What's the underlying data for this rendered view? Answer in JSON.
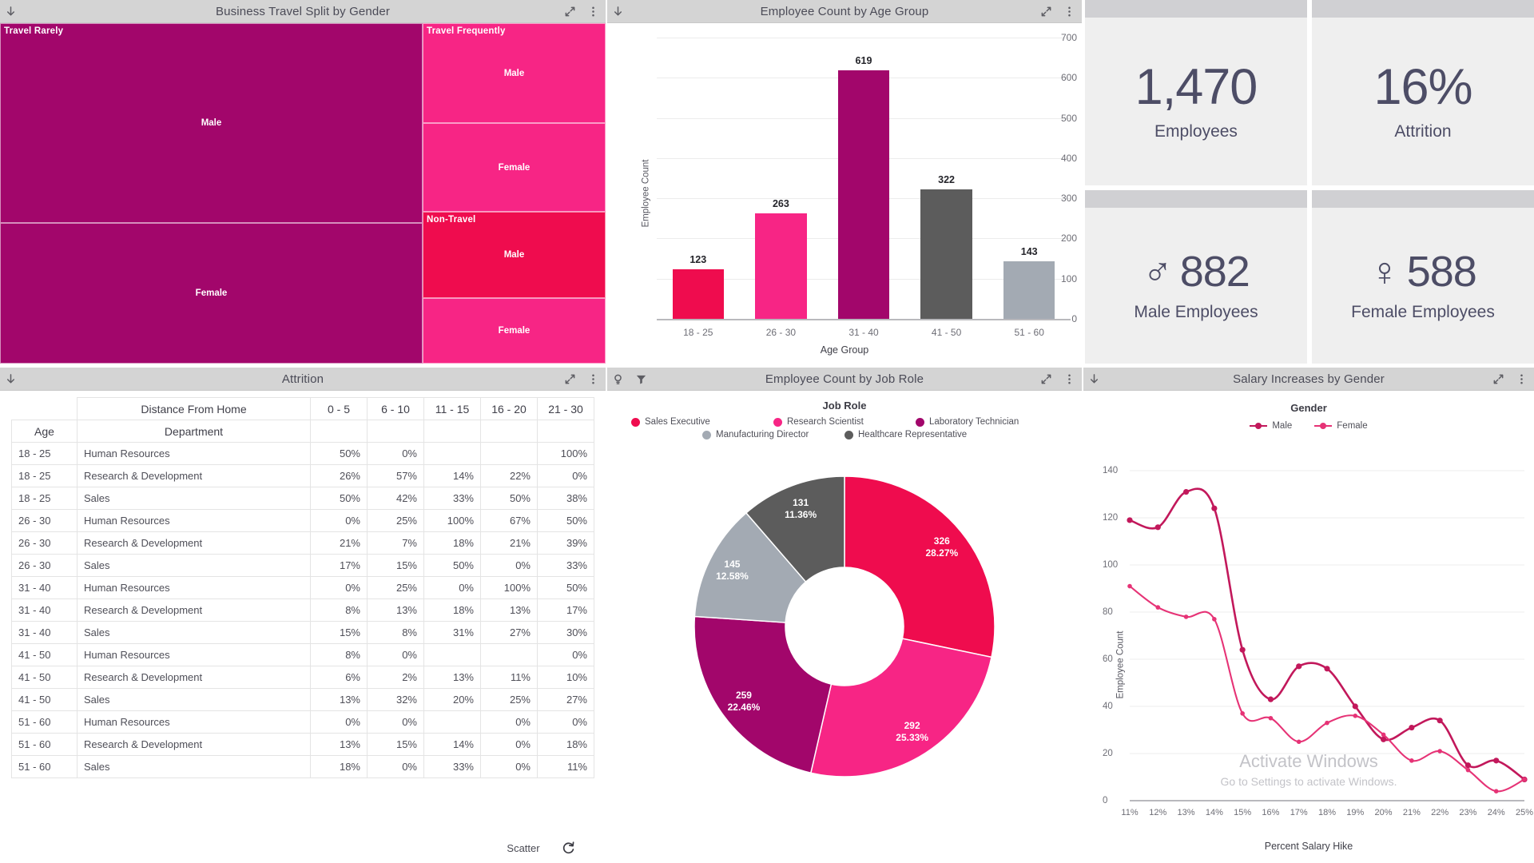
{
  "theme": {
    "crimson": "#ef0c4e",
    "pink": "#f72585",
    "magenta": "#a2066b",
    "dark_gray": "#5c5c5c",
    "light_gray": "#a3aab3",
    "panel_head": "#d4d4d4",
    "kpi_text": "#4d4d66",
    "male_line": "#c2185b",
    "female_line": "#e63376"
  },
  "icons": {
    "expand": "expand-icon",
    "more": "more-vertical-icon",
    "download": "download-arrow-icon",
    "insight": "lightbulb-icon",
    "filter": "filter-funnel-icon",
    "reset": "reset-icon"
  },
  "panels": {
    "treemap": {
      "title": "Business Travel Split by Gender"
    },
    "bar": {
      "title": "Employee Count by Age Group"
    },
    "table": {
      "title": "Attrition"
    },
    "donut": {
      "title": "Employee Count by Job Role"
    },
    "line": {
      "title": "Salary Increases by Gender"
    }
  },
  "kpis": [
    {
      "name": "employees",
      "value": "1,470",
      "label": "Employees",
      "symbol": ""
    },
    {
      "name": "attrition",
      "value": "16%",
      "label": "Attrition",
      "symbol": ""
    },
    {
      "name": "male-employees",
      "value": "882",
      "label": "Male Employees",
      "symbol": "♂"
    },
    {
      "name": "female-employees",
      "value": "588",
      "label": "Female Employees",
      "symbol": "♀"
    }
  ],
  "footer": {
    "label": "Scatter"
  },
  "chart_data": [
    {
      "type": "treemap",
      "title": "Business Travel Split by Gender",
      "groups": [
        {
          "name": "Travel Rarely",
          "color": "#a2066b",
          "children": [
            {
              "label": "Male",
              "share": 0.585
            },
            {
              "label": "Female",
              "share": 0.415
            }
          ]
        },
        {
          "name": "Travel Frequently",
          "color": "#f72585",
          "children": [
            {
              "label": "Male",
              "share": 0.555
            },
            {
              "label": "Female",
              "share": 0.445
            }
          ]
        },
        {
          "name": "Non-Travel",
          "color": "#ef0c4e",
          "children": [
            {
              "label": "Male",
              "share": 0.58
            },
            {
              "label": "Female",
              "share": 0.42
            }
          ]
        }
      ]
    },
    {
      "type": "bar",
      "title": "Employee Count by Age Group",
      "xlabel": "Age Group",
      "ylabel": "Employee Count",
      "categories": [
        "18 - 25",
        "26 - 30",
        "31 - 40",
        "41 - 50",
        "51 - 60"
      ],
      "values": [
        123,
        263,
        619,
        322,
        143
      ],
      "colors": [
        "#ef0c4e",
        "#f72585",
        "#a2066b",
        "#5c5c5c",
        "#a3aab3"
      ],
      "ylim": [
        0,
        700
      ],
      "yticks": [
        0,
        100,
        200,
        300,
        400,
        500,
        600,
        700
      ],
      "grid": true
    },
    {
      "type": "table",
      "title": "Attrition",
      "corner_headers": {
        "row1_label": "Distance From Home",
        "age": "Age",
        "department": "Department"
      },
      "columns": [
        "0 - 5",
        "6 - 10",
        "11 - 15",
        "16 - 20",
        "21 - 30"
      ],
      "rows": [
        {
          "age": "18 - 25",
          "dept": "Human Resources",
          "cells": [
            "50%",
            "0%",
            "",
            "",
            "100%"
          ]
        },
        {
          "age": "18 - 25",
          "dept": "Research & Development",
          "cells": [
            "26%",
            "57%",
            "14%",
            "22%",
            "0%"
          ]
        },
        {
          "age": "18 - 25",
          "dept": "Sales",
          "cells": [
            "50%",
            "42%",
            "33%",
            "50%",
            "38%"
          ]
        },
        {
          "age": "26 - 30",
          "dept": "Human Resources",
          "cells": [
            "0%",
            "25%",
            "100%",
            "67%",
            "50%"
          ]
        },
        {
          "age": "26 - 30",
          "dept": "Research & Development",
          "cells": [
            "21%",
            "7%",
            "18%",
            "21%",
            "39%"
          ]
        },
        {
          "age": "26 - 30",
          "dept": "Sales",
          "cells": [
            "17%",
            "15%",
            "50%",
            "0%",
            "33%"
          ]
        },
        {
          "age": "31 - 40",
          "dept": "Human Resources",
          "cells": [
            "0%",
            "25%",
            "0%",
            "100%",
            "50%"
          ]
        },
        {
          "age": "31 - 40",
          "dept": "Research & Development",
          "cells": [
            "8%",
            "13%",
            "18%",
            "13%",
            "17%"
          ]
        },
        {
          "age": "31 - 40",
          "dept": "Sales",
          "cells": [
            "15%",
            "8%",
            "31%",
            "27%",
            "30%"
          ]
        },
        {
          "age": "41 - 50",
          "dept": "Human Resources",
          "cells": [
            "8%",
            "0%",
            "",
            "",
            "0%"
          ]
        },
        {
          "age": "41 - 50",
          "dept": "Research & Development",
          "cells": [
            "6%",
            "2%",
            "13%",
            "11%",
            "10%"
          ]
        },
        {
          "age": "41 - 50",
          "dept": "Sales",
          "cells": [
            "13%",
            "32%",
            "20%",
            "25%",
            "27%"
          ]
        },
        {
          "age": "51 - 60",
          "dept": "Human Resources",
          "cells": [
            "0%",
            "0%",
            "",
            "0%",
            "0%"
          ]
        },
        {
          "age": "51 - 60",
          "dept": "Research & Development",
          "cells": [
            "13%",
            "15%",
            "14%",
            "0%",
            "18%"
          ]
        },
        {
          "age": "51 - 60",
          "dept": "Sales",
          "cells": [
            "18%",
            "0%",
            "33%",
            "0%",
            "11%"
          ]
        }
      ]
    },
    {
      "type": "pie",
      "title": "Employee Count by Job Role",
      "legend_title": "Job Role",
      "legend_position": "top",
      "labels": [
        "Sales Executive",
        "Research Scientist",
        "Laboratory Technician",
        "Manufacturing Director",
        "Healthcare Representative"
      ],
      "values": [
        326,
        292,
        259,
        145,
        131
      ],
      "percents": [
        "28.27%",
        "25.33%",
        "22.46%",
        "12.58%",
        "11.36%"
      ],
      "colors": [
        "#ef0c4e",
        "#f72585",
        "#a2066b",
        "#a3aab3",
        "#5c5c5c"
      ]
    },
    {
      "type": "line",
      "title": "Salary Increases by Gender",
      "legend_title": "Gender",
      "xlabel": "Percent Salary Hike",
      "ylabel": "Employee Count",
      "x": [
        "11%",
        "12%",
        "13%",
        "14%",
        "15%",
        "16%",
        "17%",
        "18%",
        "19%",
        "20%",
        "21%",
        "22%",
        "23%",
        "24%",
        "25%"
      ],
      "ylim": [
        0,
        140
      ],
      "yticks": [
        0,
        20,
        40,
        60,
        80,
        100,
        120,
        140
      ],
      "series": [
        {
          "name": "Male",
          "color": "#c2185b",
          "values": [
            119,
            116,
            131,
            124,
            64,
            43,
            57,
            56,
            40,
            26,
            31,
            34,
            15,
            17,
            9
          ]
        },
        {
          "name": "Female",
          "color": "#e63376",
          "values": [
            91,
            82,
            78,
            77,
            37,
            35,
            25,
            33,
            36,
            28,
            17,
            21,
            13,
            4,
            9
          ]
        }
      ]
    }
  ],
  "watermark": {
    "line1": "Activate Windows",
    "line2": "Go to Settings to activate Windows."
  }
}
